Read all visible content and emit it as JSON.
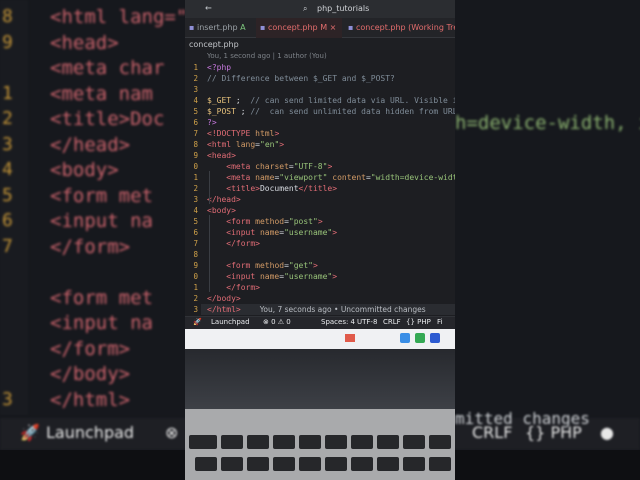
{
  "background": {
    "lines": [
      {
        "num": "8",
        "html": "<html lang=\""
      },
      {
        "num": "9",
        "html": "<head>"
      },
      {
        "num": "",
        "html": "    <meta char"
      },
      {
        "num": "1",
        "html": "    <meta nam"
      },
      {
        "num": "2",
        "html": "    <title>Doc"
      },
      {
        "num": "3",
        "html": "</head>"
      },
      {
        "num": "4",
        "html": "<body>"
      },
      {
        "num": "5",
        "html": "    <form met"
      },
      {
        "num": "6",
        "html": "    <input na"
      },
      {
        "num": "7",
        "html": "    </form>"
      },
      {
        "num": "",
        "html": ""
      },
      {
        "num": "",
        "html": "    <form met"
      },
      {
        "num": "",
        "html": "    <input na"
      },
      {
        "num": "",
        "html": "    </form>"
      },
      {
        "num": "",
        "html": "</body>"
      },
      {
        "num": "3",
        "html": "</html>"
      }
    ],
    "right_text": "h=device-width, in",
    "status_left": "Launchpad",
    "status_right": [
      "CRLF",
      "{} PHP"
    ],
    "uncommitted": "mitted changes"
  },
  "window": {
    "search": "php_tutorials"
  },
  "tabs": [
    {
      "label": "insert.php",
      "suffix": "A"
    },
    {
      "label": "concept.php",
      "suffix": "M",
      "close": "×"
    },
    {
      "label": "concept.php (Working Tree)",
      "suffix": ""
    }
  ],
  "breadcrumb": "concept.php",
  "blame_header": "You, 1 second ago | 1 author (You)",
  "code_lines": [
    {
      "n": "1",
      "segments": [
        {
          "t": "<?php",
          "c": "c-kw"
        }
      ]
    },
    {
      "n": "2",
      "segments": [
        {
          "t": "// Difference between $_GET and $_POST?",
          "c": "c-cm"
        }
      ]
    },
    {
      "n": "3",
      "segments": []
    },
    {
      "n": "4",
      "segments": [
        {
          "t": "$_GET",
          "c": "c-var"
        },
        {
          "t": " ;  ",
          "c": "c-plain"
        },
        {
          "t": "// can send limited data via URL. Visible in URL",
          "c": "c-cm"
        }
      ]
    },
    {
      "n": "5",
      "segments": [
        {
          "t": "$_POST",
          "c": "c-var"
        },
        {
          "t": " ; ",
          "c": "c-plain"
        },
        {
          "t": "//  can send unlimited data hidden from URL.",
          "c": "c-cm"
        }
      ]
    },
    {
      "n": "6",
      "segments": [
        {
          "t": "?>",
          "c": "c-kw"
        }
      ]
    },
    {
      "n": "7",
      "segments": [
        {
          "t": "<!DOCTYPE ",
          "c": "c-tag"
        },
        {
          "t": "html",
          "c": "c-attr"
        },
        {
          "t": ">",
          "c": "c-tag"
        }
      ]
    },
    {
      "n": "8",
      "segments": [
        {
          "t": "<html ",
          "c": "c-tag"
        },
        {
          "t": "lang",
          "c": "c-attr"
        },
        {
          "t": "=",
          "c": "c-plain"
        },
        {
          "t": "\"en\"",
          "c": "c-str"
        },
        {
          "t": ">",
          "c": "c-tag"
        }
      ]
    },
    {
      "n": "9",
      "segments": [
        {
          "t": "<head>",
          "c": "c-tag"
        }
      ]
    },
    {
      "n": "0",
      "segments": [
        {
          "t": "    <meta ",
          "c": "c-tag"
        },
        {
          "t": "charset",
          "c": "c-attr"
        },
        {
          "t": "=",
          "c": "c-plain"
        },
        {
          "t": "\"UTF-8\"",
          "c": "c-str"
        },
        {
          "t": ">",
          "c": "c-tag"
        }
      ]
    },
    {
      "n": "1",
      "segments": [
        {
          "t": "    <meta ",
          "c": "c-tag"
        },
        {
          "t": "name",
          "c": "c-attr"
        },
        {
          "t": "=",
          "c": "c-plain"
        },
        {
          "t": "\"viewport\" ",
          "c": "c-str"
        },
        {
          "t": "content",
          "c": "c-attr"
        },
        {
          "t": "=",
          "c": "c-plain"
        },
        {
          "t": "\"width=device-width, in",
          "c": "c-str"
        }
      ]
    },
    {
      "n": "2",
      "segments": [
        {
          "t": "    <title>",
          "c": "c-tag"
        },
        {
          "t": "Document",
          "c": "c-tx"
        },
        {
          "t": "</title>",
          "c": "c-tag"
        }
      ]
    },
    {
      "n": "3",
      "segments": [
        {
          "t": "</head>",
          "c": "c-tag"
        }
      ]
    },
    {
      "n": "4",
      "segments": [
        {
          "t": "<body>",
          "c": "c-tag"
        }
      ]
    },
    {
      "n": "5",
      "segments": [
        {
          "t": "    <form ",
          "c": "c-tag"
        },
        {
          "t": "method",
          "c": "c-attr"
        },
        {
          "t": "=",
          "c": "c-plain"
        },
        {
          "t": "\"post\"",
          "c": "c-str"
        },
        {
          "t": ">",
          "c": "c-tag"
        }
      ]
    },
    {
      "n": "6",
      "segments": [
        {
          "t": "    <input ",
          "c": "c-tag"
        },
        {
          "t": "name",
          "c": "c-attr"
        },
        {
          "t": "=",
          "c": "c-plain"
        },
        {
          "t": "\"username\"",
          "c": "c-str"
        },
        {
          "t": ">",
          "c": "c-tag"
        }
      ]
    },
    {
      "n": "7",
      "segments": [
        {
          "t": "    </form>",
          "c": "c-tag"
        }
      ]
    },
    {
      "n": "8",
      "segments": []
    },
    {
      "n": "9",
      "segments": [
        {
          "t": "    <form ",
          "c": "c-tag"
        },
        {
          "t": "method",
          "c": "c-attr"
        },
        {
          "t": "=",
          "c": "c-plain"
        },
        {
          "t": "\"get\"",
          "c": "c-str"
        },
        {
          "t": ">",
          "c": "c-tag"
        }
      ]
    },
    {
      "n": "0",
      "segments": [
        {
          "t": "    <input ",
          "c": "c-tag"
        },
        {
          "t": "name",
          "c": "c-attr"
        },
        {
          "t": "=",
          "c": "c-plain"
        },
        {
          "t": "\"username\"",
          "c": "c-str"
        },
        {
          "t": ">",
          "c": "c-tag"
        }
      ]
    },
    {
      "n": "1",
      "segments": [
        {
          "t": "    </form>",
          "c": "c-tag"
        }
      ]
    },
    {
      "n": "2",
      "segments": [
        {
          "t": "</body>",
          "c": "c-tag"
        }
      ]
    },
    {
      "n": "3",
      "segments": [
        {
          "t": "</html>",
          "c": "c-tag"
        },
        {
          "t": "        You, 7 seconds ago • Uncommitted changes",
          "c": "inline-blame"
        }
      ]
    }
  ],
  "statusbar": {
    "launchpad": "Launchpad",
    "problems": "⊗ 0 ⚠ 0",
    "spaces": "Spaces: 4",
    "encoding": "UTF-8",
    "eol": "CRLF",
    "language": "{} PHP",
    "extra": "Fi"
  },
  "colors": {
    "editor_bg": "#1d1e22",
    "line_number": "#d0a24a",
    "tab_modified": "#e36d6d"
  }
}
